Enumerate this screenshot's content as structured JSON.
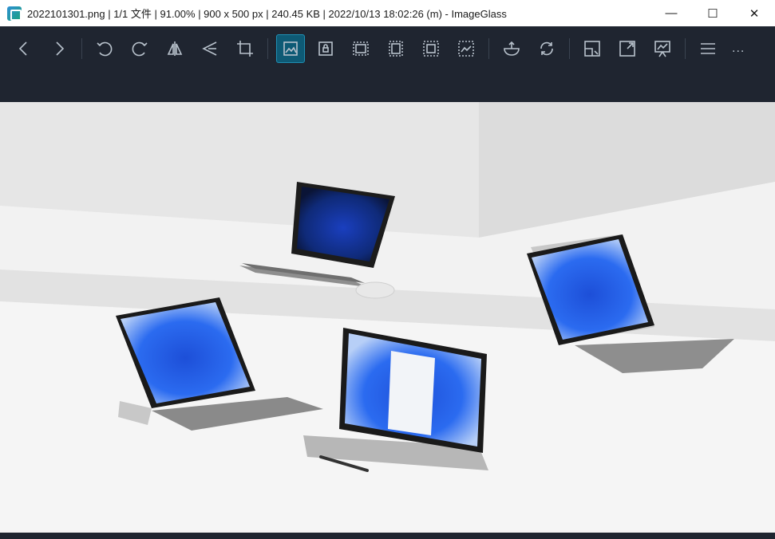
{
  "window": {
    "title": "2022101301.png  |  1/1 文件  |  91.00%  |  900 x 500 px  |  240.45 KB  |  2022/10/13 18:02:26 (m)  - ImageGlass",
    "controls": {
      "minimize": "—",
      "maximize": "☐",
      "close": "✕"
    }
  },
  "toolbar": {
    "more_label": "...",
    "buttons": [
      {
        "name": "previous-icon"
      },
      {
        "name": "next-icon"
      },
      {
        "name": "rotate-left-icon"
      },
      {
        "name": "rotate-right-icon"
      },
      {
        "name": "flip-horizontal-icon"
      },
      {
        "name": "flip-vertical-icon"
      },
      {
        "name": "crop-icon"
      },
      {
        "name": "auto-zoom-icon",
        "active": true
      },
      {
        "name": "lock-zoom-icon"
      },
      {
        "name": "scale-to-width-icon"
      },
      {
        "name": "scale-to-height-icon"
      },
      {
        "name": "scale-to-fit-icon"
      },
      {
        "name": "scale-to-fill-icon"
      },
      {
        "name": "open-with-icon"
      },
      {
        "name": "refresh-icon"
      },
      {
        "name": "gallery-icon"
      },
      {
        "name": "fullscreen-icon"
      },
      {
        "name": "slideshow-icon"
      },
      {
        "name": "menu-icon"
      }
    ]
  },
  "colors": {
    "toolbar_bg": "#1f2530",
    "accent": "#1f8fb3",
    "icon": "#b8c2cc"
  },
  "image": {
    "filename": "2022101301.png",
    "zoom": "91.00%",
    "dimensions": "900 x 500 px",
    "size": "240.45 KB",
    "date": "2022/10/13 18:02:26 (m)",
    "content": "Surface devices with Windows 11 wallpaper on white steps"
  }
}
